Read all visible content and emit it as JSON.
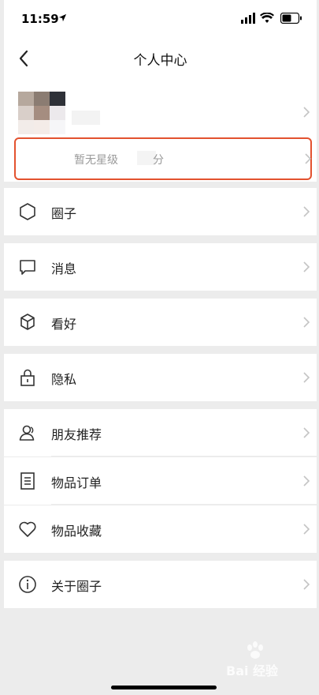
{
  "status_bar": {
    "time": "11:59"
  },
  "nav": {
    "title": "个人中心"
  },
  "profile": {
    "rating_text": "暂无星级",
    "rating_unit": "分"
  },
  "menu": [
    {
      "label": "圈子",
      "icon": "hexagon-icon"
    },
    {
      "label": "消息",
      "icon": "message-icon"
    },
    {
      "label": "看好",
      "icon": "cube-icon"
    },
    {
      "label": "隐私",
      "icon": "lock-icon"
    },
    {
      "label": "朋友推荐",
      "icon": "friends-icon"
    },
    {
      "label": "物品订单",
      "icon": "list-icon"
    },
    {
      "label": "物品收藏",
      "icon": "heart-icon"
    },
    {
      "label": "关于圈子",
      "icon": "info-icon"
    }
  ],
  "watermark": {
    "text": "Bai 经验"
  },
  "colors": {
    "highlight": "#e3522f",
    "background": "#ececec"
  }
}
